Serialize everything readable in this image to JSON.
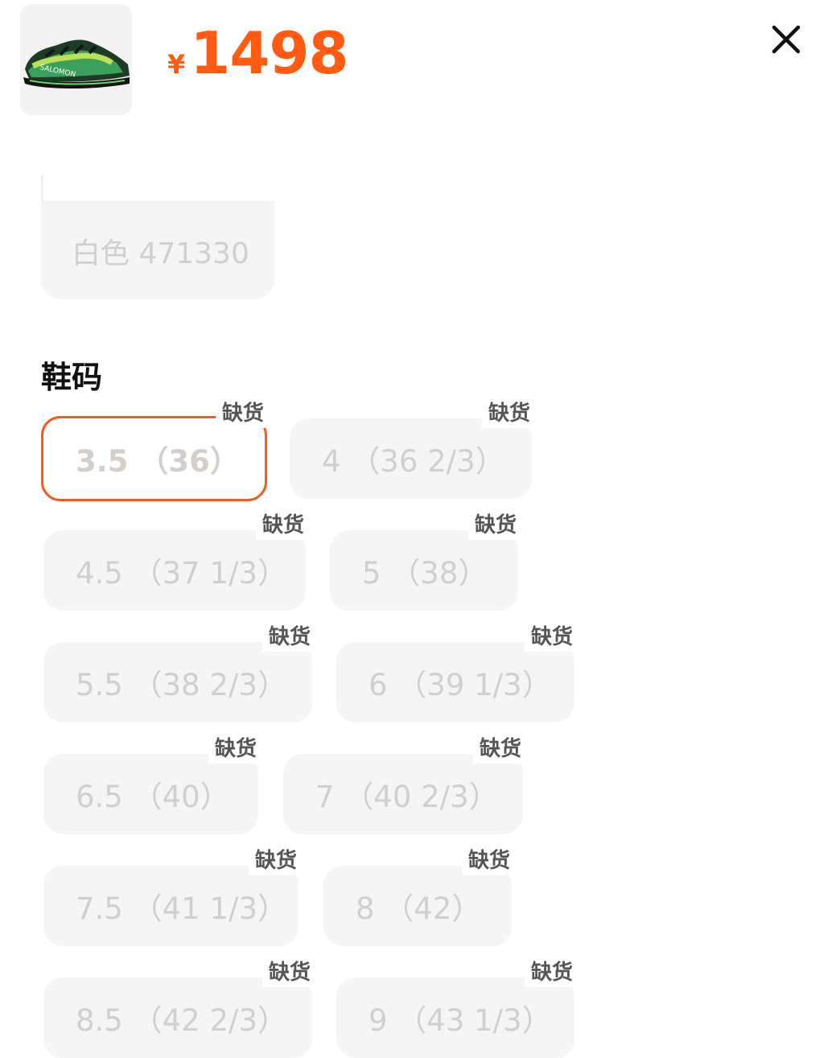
{
  "product": {
    "image_icon": "sneaker-thumbnail",
    "currency": "¥",
    "price": "1498"
  },
  "close_icon": "close-icon",
  "color_option": {
    "label": "白色 471330"
  },
  "size_section": {
    "title": "鞋码",
    "sizes": [
      {
        "label": "3.5 （36）",
        "status": "缺货",
        "selected": true
      },
      {
        "label": "4 （36 2/3）",
        "status": "缺货"
      },
      {
        "label": "4.5 （37 1/3）",
        "status": "缺货"
      },
      {
        "label": "5 （38）",
        "status": "缺货"
      },
      {
        "label": "5.5 （38 2/3）",
        "status": "缺货"
      },
      {
        "label": "6 （39 1/3）",
        "status": "缺货"
      },
      {
        "label": "6.5 （40）",
        "status": "缺货"
      },
      {
        "label": "7 （40 2/3）",
        "status": "缺货"
      },
      {
        "label": "7.5 （41 1/3）",
        "status": "缺货"
      },
      {
        "label": "8 （42）",
        "status": "缺货"
      },
      {
        "label": "8.5 （42 2/3）",
        "status": "缺货"
      },
      {
        "label": "9 （43 1/3）",
        "status": "缺货"
      }
    ]
  },
  "colors": {
    "accent": "#ff5a12",
    "selected_border": "#ef5d24",
    "chip_bg": "#f5f5f5",
    "disabled_text": "#cfcfcf"
  }
}
